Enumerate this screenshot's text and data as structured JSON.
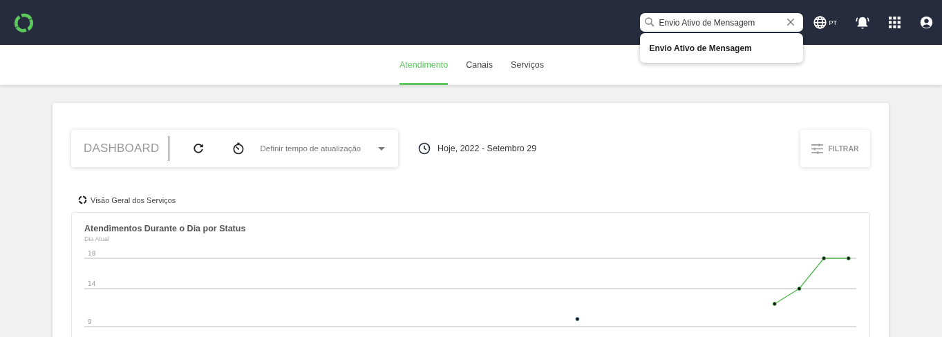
{
  "header": {
    "search": {
      "value": "Envio Ativo de Mensagem",
      "suggestions": [
        "Envio Ativo de Mensagem"
      ]
    },
    "language": "PT"
  },
  "tabs": [
    {
      "label": "Atendimento",
      "selected": true
    },
    {
      "label": "Canais",
      "selected": false
    },
    {
      "label": "Serviços",
      "selected": false
    }
  ],
  "toolbar": {
    "title": "DASHBOARD",
    "refresh_select": {
      "placeholder": "Definir tempo de atualização"
    },
    "date": "Hoje, 2022 - Setembro 29",
    "filter_button": "FILTRAR"
  },
  "section": {
    "title": "Visão Geral dos Serviços"
  },
  "chart": {
    "title": "Atendimentos Durante o Dia por Status",
    "subtitle": "Dia Atual",
    "chart_data": {
      "type": "line",
      "ylim": [
        9,
        18
      ],
      "yticks": [
        9,
        14,
        18
      ],
      "series": [
        {
          "color": "#4a90c8",
          "marker": "circle",
          "values": [
            null,
            null,
            null,
            null,
            null,
            null,
            null,
            null,
            null,
            null,
            null,
            null,
            null,
            null,
            null,
            null,
            null,
            null,
            null,
            null,
            10,
            null,
            null,
            null,
            null,
            null,
            null,
            null,
            null,
            null,
            null,
            null
          ]
        },
        {
          "color": "#4cb84c",
          "marker": "circle",
          "values": [
            null,
            null,
            null,
            null,
            null,
            null,
            null,
            null,
            null,
            null,
            null,
            null,
            null,
            null,
            null,
            null,
            null,
            null,
            null,
            null,
            null,
            null,
            null,
            null,
            null,
            null,
            null,
            null,
            12,
            14,
            18,
            18
          ]
        }
      ]
    }
  }
}
